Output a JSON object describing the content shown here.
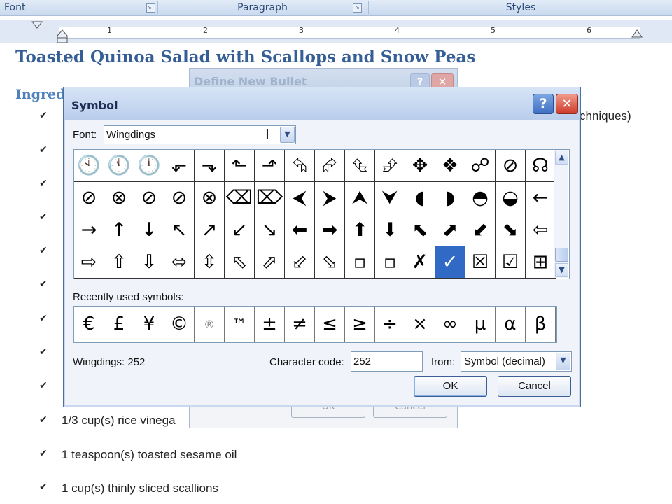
{
  "ribbon": {
    "groups": [
      "Font",
      "Paragraph",
      "Styles"
    ]
  },
  "ruler": {
    "numbers": [
      "1",
      "2",
      "3",
      "4",
      "5",
      "6"
    ]
  },
  "document": {
    "title": "Toasted Quinoa Salad with Scallops and Snow Peas",
    "heading": "Ingred",
    "bullet_glyph": "✔",
    "right_fragment": "chniques)",
    "items": [
      "1/3 cup(s) rice vinega",
      "1 teaspoon(s) toasted sesame oil",
      "1 cup(s) thinly sliced scallions"
    ]
  },
  "bg_dialog": {
    "title": "Define New Bullet",
    "help": "?",
    "close": "✕",
    "ok": "OK",
    "cancel": "Cancel"
  },
  "symbol_dialog": {
    "title": "Symbol",
    "help": "?",
    "close": "✕",
    "font_label": "Font:",
    "font_value": "Wingdings",
    "recent_label": "Recently used symbols:",
    "char_name": "Wingdings: 252",
    "code_label": "Character code:",
    "code_value": "252",
    "from_label": "from:",
    "from_value": "Symbol (decimal)",
    "ok_label": "OK",
    "cancel_label": "Cancel",
    "grid_rows": [
      [
        "🕙",
        "🕚",
        "🕛",
        "⬐",
        "⬎",
        "⬑",
        "⬏",
        "⮲",
        "⮳",
        "⮴",
        "⮵",
        "✥",
        "❖",
        "☍",
        "⊘",
        "☊"
      ],
      [
        "⊘",
        "⊗",
        "⊘",
        "⊘",
        "⊗",
        "⌫",
        "⌦",
        "⮜",
        "⮞",
        "⮝",
        "⮟",
        "◖",
        "◗",
        "◓",
        "◒",
        "←"
      ],
      [
        "→",
        "↑",
        "↓",
        "↖",
        "↗",
        "↙",
        "↘",
        "⬅",
        "➡",
        "⬆",
        "⬇",
        "⬉",
        "⬈",
        "⬋",
        "⬊",
        "⇦"
      ],
      [
        "⇨",
        "⇧",
        "⇩",
        "⬄",
        "⇳",
        "⬁",
        "⬀",
        "⬃",
        "⬂",
        "▫",
        "▫",
        "✗",
        "✓",
        "☒",
        "☑",
        "⊞"
      ]
    ],
    "selected_row": 3,
    "selected_col": 12,
    "recent": [
      "€",
      "£",
      "¥",
      "©",
      "®",
      "™",
      "±",
      "≠",
      "≤",
      "≥",
      "÷",
      "×",
      "∞",
      "µ",
      "α",
      "β"
    ],
    "scroll_up": "▲",
    "scroll_down": "▼",
    "dropdown_arrow": "▼"
  }
}
